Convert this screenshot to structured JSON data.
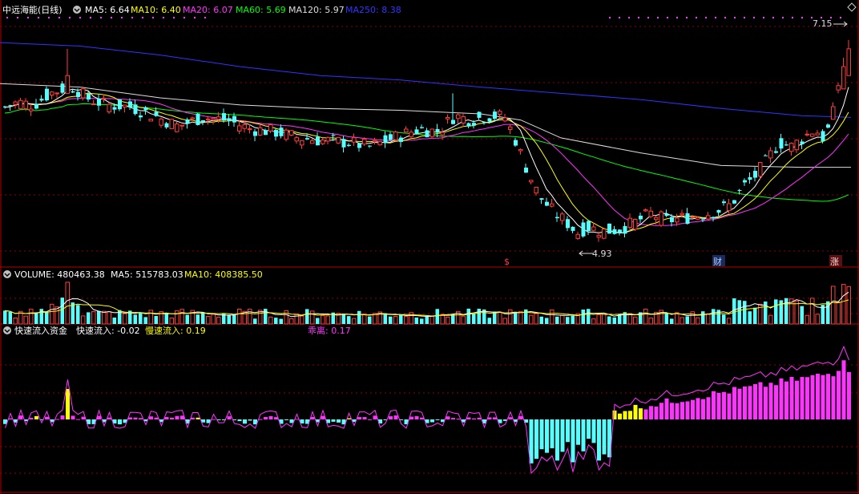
{
  "header": {
    "title": "中远海能(日线)",
    "ma": [
      {
        "label": "MA5: 6.64",
        "color": "#ffffff"
      },
      {
        "label": "MA10: 6.40",
        "color": "#ffff00"
      },
      {
        "label": "MA20: 6.07",
        "color": "#ff33ff"
      },
      {
        "label": "MA60: 5.69",
        "color": "#00ff00"
      },
      {
        "label": "MA120: 5.97",
        "color": "#dddddd"
      },
      {
        "label": "MA250: 8.38",
        "color": "#3333ff"
      }
    ]
  },
  "volume_header": {
    "volume": "VOLUME: 480463.38",
    "ma5": "MA5: 515783.03",
    "ma10": "MA10: 408385.50"
  },
  "indicator_header": {
    "name": "快速流入资金",
    "fast": "快速流入: -0.02",
    "slow": "慢速流入: 0.19",
    "deviation": "乖离: 0.17"
  },
  "annotations": {
    "high_price": "7.15",
    "low_price": "4.93",
    "marker_s": "$",
    "marker_cai": "财",
    "marker_zhang": "涨"
  },
  "colors": {
    "up": "#ff3b3b",
    "down": "#54ffff",
    "grid": "#8b0000",
    "ma5": "#ffffff",
    "ma10": "#ffff00",
    "ma20": "#ff33ff",
    "ma60": "#00ff00",
    "ma120": "#dddddd",
    "ma250": "#3333ff",
    "fast": "#54ffff",
    "slow": "#ffff00",
    "deviation": "#ff33ff"
  },
  "chart_data": {
    "type": "candlestick",
    "price_range": [
      4.6,
      7.4
    ],
    "ma_lines": {
      "ma250": [
        [
          0,
          7.12
        ],
        [
          100,
          7.08
        ],
        [
          200,
          6.98
        ],
        [
          300,
          6.85
        ],
        [
          400,
          6.75
        ],
        [
          500,
          6.7
        ],
        [
          600,
          6.62
        ],
        [
          700,
          6.55
        ],
        [
          800,
          6.48
        ],
        [
          900,
          6.38
        ],
        [
          1000,
          6.3
        ],
        [
          1062,
          6.28
        ]
      ],
      "ma120": [
        [
          0,
          6.66
        ],
        [
          100,
          6.62
        ],
        [
          200,
          6.5
        ],
        [
          300,
          6.42
        ],
        [
          400,
          6.38
        ],
        [
          500,
          6.36
        ],
        [
          600,
          6.32
        ],
        [
          650,
          6.25
        ],
        [
          700,
          6.05
        ],
        [
          800,
          5.88
        ],
        [
          900,
          5.74
        ],
        [
          1000,
          5.72
        ],
        [
          1062,
          5.72
        ]
      ]
    }
  }
}
